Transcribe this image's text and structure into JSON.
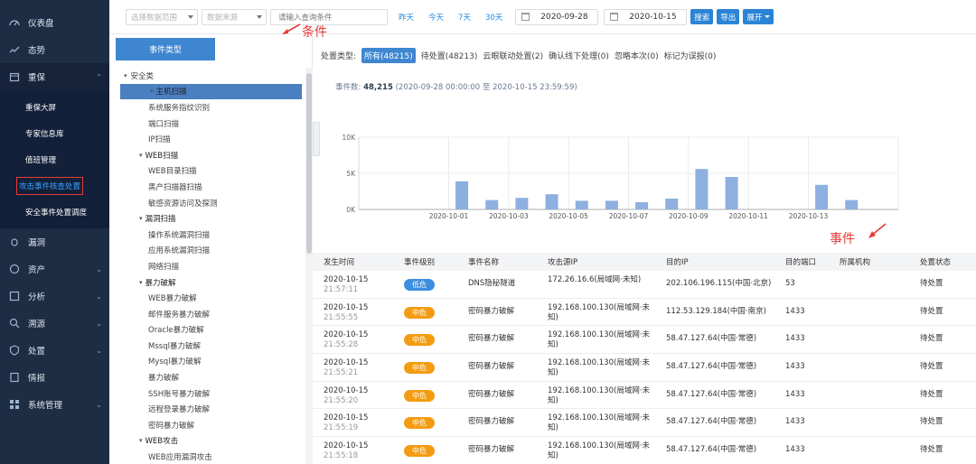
{
  "nav": {
    "items": [
      {
        "label": "仪表盘",
        "icon": "dashboard-icon"
      },
      {
        "label": "态势",
        "icon": "trend-icon"
      },
      {
        "label": "重保",
        "icon": "calendar-icon",
        "open": true
      },
      {
        "label": "漏洞",
        "icon": "bug-icon"
      },
      {
        "label": "资产",
        "icon": "asset-icon"
      },
      {
        "label": "分析",
        "icon": "analysis-icon"
      },
      {
        "label": "溯源",
        "icon": "trace-icon"
      },
      {
        "label": "处置",
        "icon": "shield-icon"
      },
      {
        "label": "情报",
        "icon": "intel-icon"
      },
      {
        "label": "系统管理",
        "icon": "settings-icon"
      }
    ],
    "sub_items": [
      "重保大屏",
      "专家信息库",
      "值班管理",
      "攻击事件核查处置",
      "安全事件处置调度"
    ]
  },
  "toolbar": {
    "scope_placeholder": "选择数据范围",
    "source_placeholder": "数据来源",
    "query_placeholder": "请输入查询条件",
    "quick_ranges": [
      "昨天",
      "今天",
      "7天",
      "30天"
    ],
    "start_date": "2020-09-28",
    "end_date": "2020-10-15",
    "search_label": "搜索",
    "export_label": "导出",
    "expand_label": "展开"
  },
  "annotations": {
    "condition": "条件",
    "event": "事件"
  },
  "tree": {
    "title": "事件类型",
    "nodes": [
      {
        "label": "安全类",
        "level": 1
      },
      {
        "label": "主机扫描",
        "level": 2,
        "group": true,
        "selected": true
      },
      {
        "label": "系统服务指纹识别",
        "level": 3
      },
      {
        "label": "端口扫描",
        "level": 3
      },
      {
        "label": "IP扫描",
        "level": 3
      },
      {
        "label": "WEB扫描",
        "level": 2,
        "group": true
      },
      {
        "label": "WEB目录扫描",
        "level": 3
      },
      {
        "label": "黑产扫描器扫描",
        "level": 3
      },
      {
        "label": "敏感资源访问及探测",
        "level": 3
      },
      {
        "label": "漏洞扫描",
        "level": 2,
        "group": true
      },
      {
        "label": "操作系统漏洞扫描",
        "level": 3
      },
      {
        "label": "应用系统漏洞扫描",
        "level": 3
      },
      {
        "label": "网络扫描",
        "level": 3
      },
      {
        "label": "暴力破解",
        "level": 2,
        "group": true
      },
      {
        "label": "WEB暴力破解",
        "level": 3
      },
      {
        "label": "邮件服务暴力破解",
        "level": 3
      },
      {
        "label": "Oracle暴力破解",
        "level": 3
      },
      {
        "label": "Mssql暴力破解",
        "level": 3
      },
      {
        "label": "Mysql暴力破解",
        "level": 3
      },
      {
        "label": "暴力破解",
        "level": 3
      },
      {
        "label": "SSH账号暴力破解",
        "level": 3
      },
      {
        "label": "远程登录暴力破解",
        "level": 3
      },
      {
        "label": "密码暴力破解",
        "level": 3
      },
      {
        "label": "WEB攻击",
        "level": 2,
        "group": true
      },
      {
        "label": "WEB应用漏洞攻击",
        "level": 3
      }
    ]
  },
  "filters": {
    "label": "处置类型:",
    "chips": [
      "所有(48215)",
      "待处置(48213)",
      "云眼联动处置(2)",
      "确认线下处理(0)",
      "忽略本次(0)",
      "标记为误报(0)"
    ]
  },
  "summary": {
    "label": "事件数:",
    "count": "48,215",
    "range": "(2020-09-28 00:00:00 至 2020-10-15 23:59:59)"
  },
  "chart_data": {
    "type": "bar",
    "x_tick_labels": [
      "2020-10-01",
      "2020-10-03",
      "2020-10-05",
      "2020-10-07",
      "2020-10-09",
      "2020-10-11",
      "2020-10-13"
    ],
    "y_tick_labels": [
      "0K",
      "5K",
      "10K"
    ],
    "categories": [
      "2020-09-28",
      "2020-09-29",
      "2020-09-30",
      "2020-10-01",
      "2020-10-02",
      "2020-10-03",
      "2020-10-04",
      "2020-10-05",
      "2020-10-06",
      "2020-10-07",
      "2020-10-08",
      "2020-10-09",
      "2020-10-10",
      "2020-10-11",
      "2020-10-12",
      "2020-10-13",
      "2020-10-14",
      "2020-10-15"
    ],
    "values": [
      0,
      0,
      0,
      3900,
      1300,
      1600,
      2100,
      1200,
      1200,
      1000,
      1500,
      5600,
      4500,
      0,
      0,
      3400,
      1300,
      0
    ],
    "ylim": [
      0,
      10000
    ],
    "color": "#8eb0e0"
  },
  "table": {
    "columns": [
      "发生时间",
      "事件级别",
      "事件名称",
      "攻击源IP",
      "目的IP",
      "目的端口",
      "所属机构",
      "处置状态"
    ],
    "rows": [
      {
        "date": "2020-10-15",
        "time": "21:57:11",
        "level": "低危",
        "level_type": "low",
        "name": "DNS隐秘隧道",
        "src": "172.26.16.6(局域网·未知)",
        "dst": "202.106.196.115(中国·北京)",
        "port": "53",
        "org": "",
        "status": "待处置"
      },
      {
        "date": "2020-10-15",
        "time": "21:55:55",
        "level": "中危",
        "level_type": "mid",
        "name": "密码暴力破解",
        "src": "192.168.100.130(局域网·未知)",
        "dst": "112.53.129.184(中国·南京)",
        "port": "1433",
        "org": "",
        "status": "待处置"
      },
      {
        "date": "2020-10-15",
        "time": "21:55:28",
        "level": "中危",
        "level_type": "mid",
        "name": "密码暴力破解",
        "src": "192.168.100.130(局域网·未知)",
        "dst": "58.47.127.64(中国·常德)",
        "port": "1433",
        "org": "",
        "status": "待处置"
      },
      {
        "date": "2020-10-15",
        "time": "21:55:21",
        "level": "中危",
        "level_type": "mid",
        "name": "密码暴力破解",
        "src": "192.168.100.130(局域网·未知)",
        "dst": "58.47.127.64(中国·常德)",
        "port": "1433",
        "org": "",
        "status": "待处置"
      },
      {
        "date": "2020-10-15",
        "time": "21:55:20",
        "level": "中危",
        "level_type": "mid",
        "name": "密码暴力破解",
        "src": "192.168.100.130(局域网·未知)",
        "dst": "58.47.127.64(中国·常德)",
        "port": "1433",
        "org": "",
        "status": "待处置"
      },
      {
        "date": "2020-10-15",
        "time": "21:55:19",
        "level": "中危",
        "level_type": "mid",
        "name": "密码暴力破解",
        "src": "192.168.100.130(局域网·未知)",
        "dst": "58.47.127.64(中国·常德)",
        "port": "1433",
        "org": "",
        "status": "待处置"
      },
      {
        "date": "2020-10-15",
        "time": "21:55:18",
        "level": "中危",
        "level_type": "mid",
        "name": "密码暴力破解",
        "src": "192.168.100.130(局域网·未知)",
        "dst": "58.47.127.64(中国·常德)",
        "port": "1433",
        "org": "",
        "status": "待处置"
      }
    ]
  }
}
